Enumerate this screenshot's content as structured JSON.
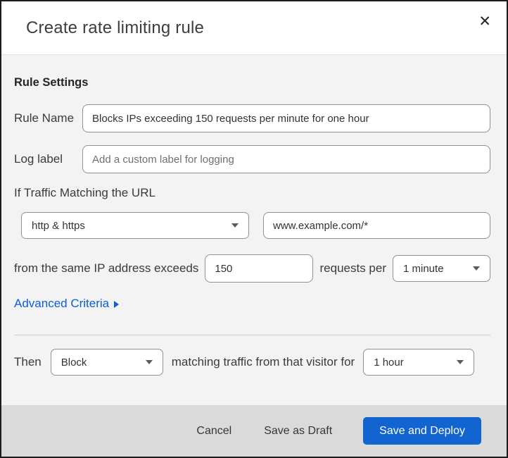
{
  "modal": {
    "title": "Create rate limiting rule",
    "close_glyph": "✕"
  },
  "form": {
    "section_heading": "Rule Settings",
    "rule_name": {
      "label": "Rule Name",
      "value": "Blocks IPs exceeding 150 requests per minute for one hour"
    },
    "log_label": {
      "label": "Log label",
      "placeholder": "Add a custom label for logging"
    },
    "traffic_match": {
      "heading": "If Traffic Matching the URL",
      "scheme_selected": "http & https",
      "url_value": "www.example.com/*"
    },
    "threshold": {
      "prefix_text": "from the same IP address exceeds",
      "requests_value": "150",
      "middle_text": "requests per",
      "period_selected": "1 minute"
    },
    "advanced_criteria_label": "Advanced Criteria",
    "then": {
      "label": "Then",
      "action_selected": "Block",
      "middle_text": "matching traffic from that visitor for",
      "duration_selected": "1 hour"
    }
  },
  "footer": {
    "cancel_label": "Cancel",
    "save_draft_label": "Save as Draft",
    "save_deploy_label": "Save and Deploy"
  },
  "colors": {
    "primary_button_blue": "#1264d1",
    "link_blue": "#0b5ed7",
    "body_background": "#f3f3f3",
    "footer_background": "#dadada",
    "peek_red": "#3d1716",
    "peek_navy": "#0d2233"
  }
}
